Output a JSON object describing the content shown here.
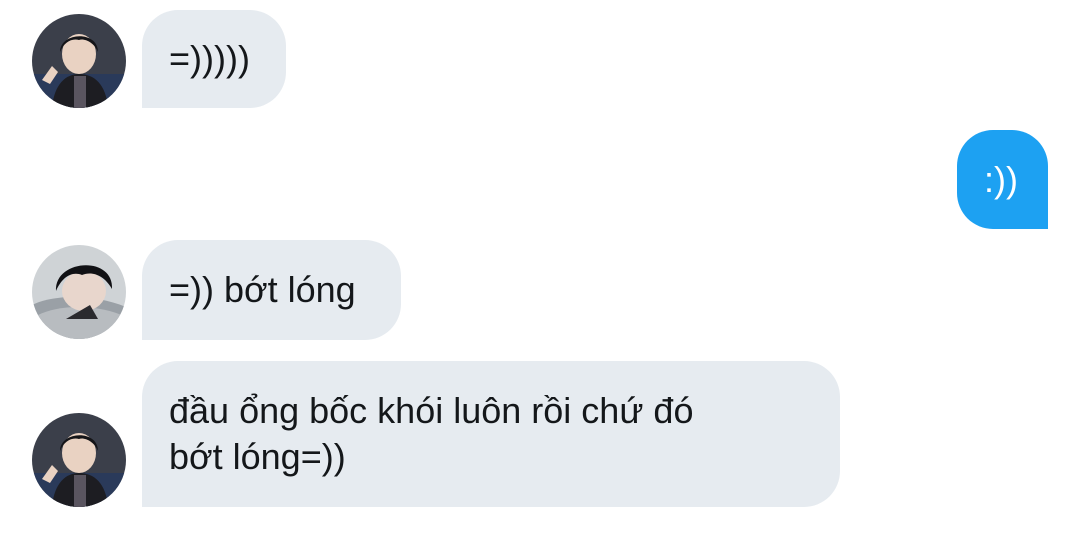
{
  "conversation": {
    "messages": [
      {
        "direction": "received",
        "text": "=)))))"
      },
      {
        "direction": "sent",
        "text": ":))"
      },
      {
        "direction": "received",
        "text": "=)) bớt lóng"
      },
      {
        "direction": "received",
        "lines": [
          "đầu ổng bốc khói luôn rồi chứ đó",
          "bớt lóng=))"
        ]
      }
    ]
  },
  "colors": {
    "received_bubble": "#e6ebf0",
    "sent_bubble": "#1da1f2",
    "received_text": "#14171a",
    "sent_text": "#ffffff"
  }
}
